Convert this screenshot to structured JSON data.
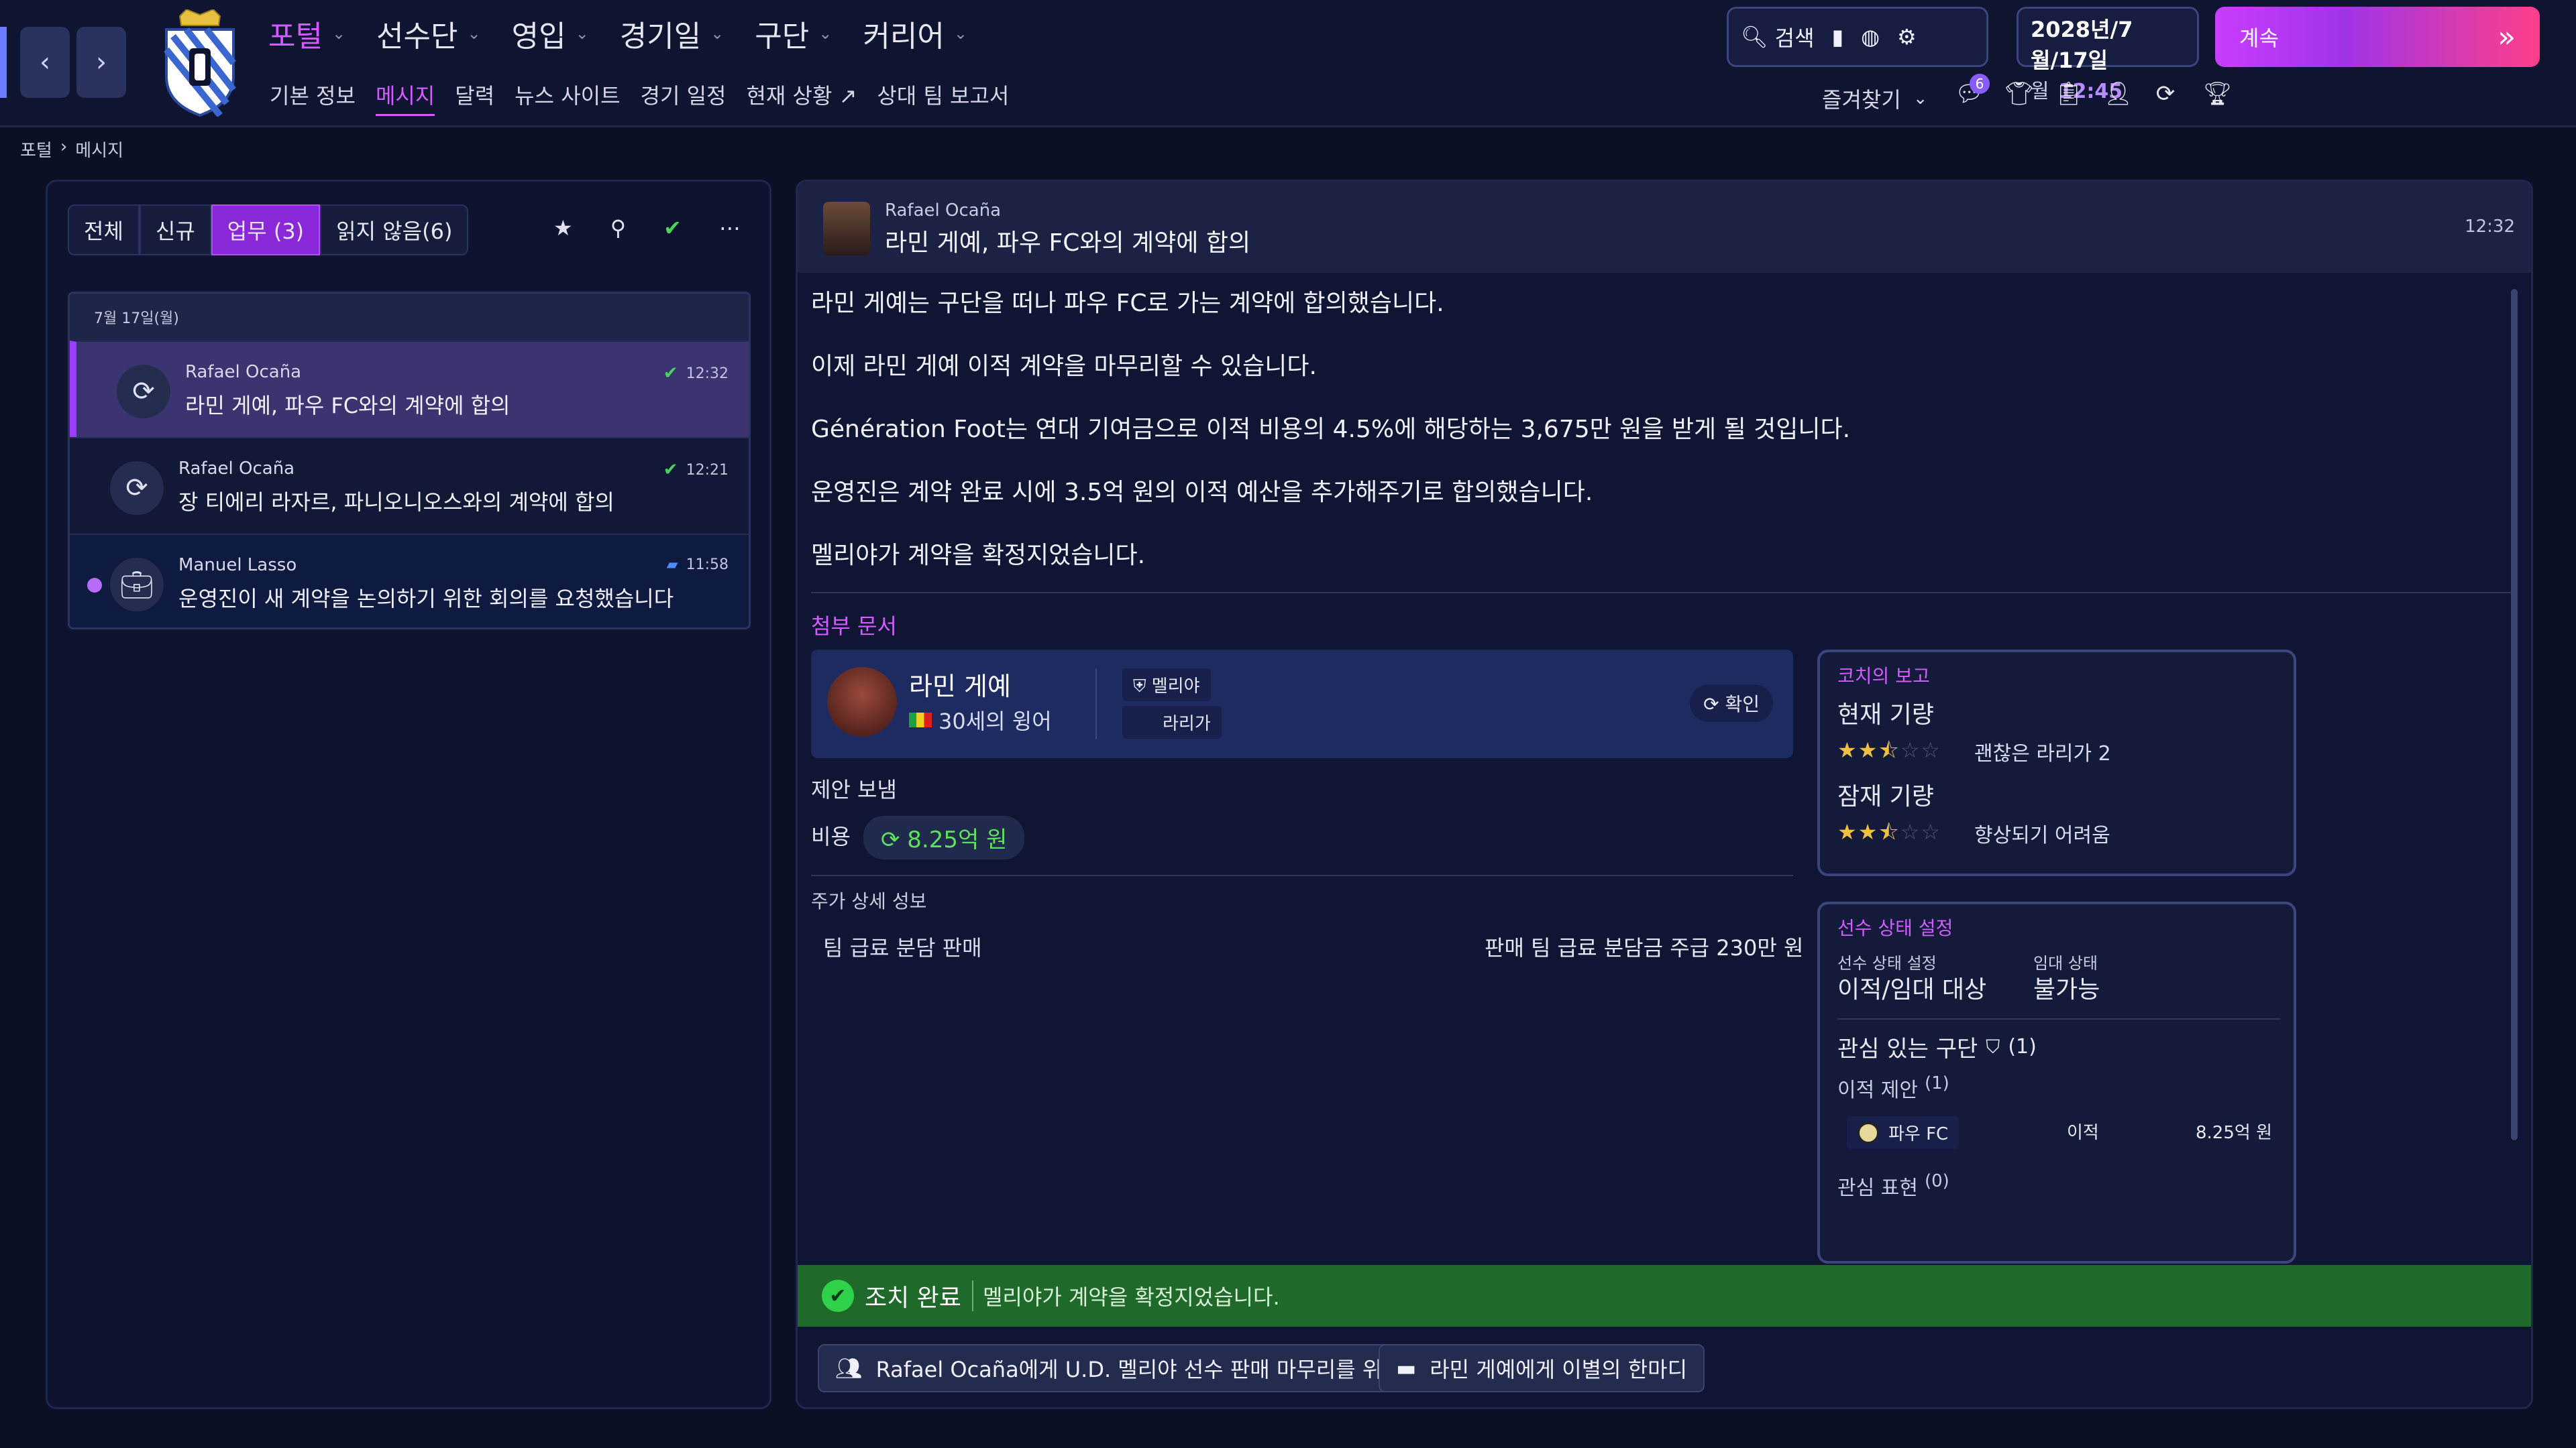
{
  "topbar": {
    "back": "‹",
    "forward": "›",
    "main_menu": [
      {
        "label": "포털",
        "active": true
      },
      {
        "label": "선수단",
        "active": false
      },
      {
        "label": "영입",
        "active": false
      },
      {
        "label": "경기일",
        "active": false
      },
      {
        "label": "구단",
        "active": false
      },
      {
        "label": "커리어",
        "active": false
      }
    ],
    "sub_menu": [
      "기본 정보",
      "메시지",
      "달력",
      "뉴스 사이트",
      "경기 일정",
      "현재 상황",
      "상대 팀 보고서"
    ],
    "search_label": "검색",
    "date_line1": "2028년/7월/17일",
    "date_weekday": "월",
    "date_time": "12:45",
    "continue_label": "계속",
    "favorites_label": "즐겨찾기",
    "notification_count": "6"
  },
  "breadcrumb": {
    "root": "포털",
    "current": "메시지"
  },
  "inbox": {
    "filters": [
      {
        "label": "전체",
        "active": false
      },
      {
        "label": "신규",
        "active": false
      },
      {
        "label": "업무 (3)",
        "active": true
      },
      {
        "label": "읽지 않음(6)",
        "active": false
      }
    ],
    "date_header": "7월 17일(월)",
    "messages": [
      {
        "sender": "Rafael Ocaña",
        "subject": "라민 게예, 파우 FC와의 계약에 합의",
        "time": "12:32",
        "selected": true,
        "unread": false
      },
      {
        "sender": "Rafael Ocaña",
        "subject": "장 티에리 라자르, 파니오니오스와의 계약에 합의",
        "time": "12:21",
        "selected": false,
        "unread": false
      },
      {
        "sender": "Manuel Lasso",
        "subject": "운영진이 새 계약을 논의하기 위한 회의를 요청했습니다",
        "time": "11:58",
        "selected": false,
        "unread": true
      }
    ]
  },
  "message": {
    "from": "Rafael Ocaña",
    "title": "라민 게예, 파우 FC와의 계약에 합의",
    "time": "12:32",
    "paragraphs": [
      "라민 게예는 구단을 떠나 파우 FC로 가는 계약에 합의했습니다.",
      "이제 라민 게예 이적 계약을 마무리할 수 있습니다.",
      "Génération Foot는 연대 기여금으로 이적 비용의 4.5%에 해당하는 3,675만 원을 받게 될 것입니다.",
      "운영진은 계약 완료 시에 3.5억 원의 이적 예산을 추가해주기로 합의했습니다.",
      "멜리야가 계약을 확정지었습니다."
    ],
    "attachments_label": "첨부 문서",
    "player": {
      "name": "라민 게예",
      "info": "30세의 윙어",
      "club": "멜리야",
      "league": "라리가",
      "confirm": "확인"
    },
    "offer_sent": "제안 보냄",
    "fee_label": "비용",
    "fee_value": "8.25억 원",
    "bonus_label": "주가 상세 성보",
    "bonus_left": "팀 급료 분담 판매",
    "bonus_right": "판매 팀 급료 분담금 주급 230만 원",
    "coach": {
      "title": "코치의 보고",
      "current_label": "현재 기량",
      "current_stars": 2.5,
      "current_text": "괜찮은 라리가 2",
      "potential_label": "잠재 기량",
      "potential_stars": 2.5,
      "potential_text": "향상되기 어려움"
    },
    "status": {
      "title": "선수 상태 설정",
      "state_label": "선수 상태 설정",
      "state_value": "이적/임대 대상",
      "loan_label": "임대 상태",
      "loan_value": "불가능",
      "interest_title": "관심 있는 구단",
      "interest_count": "(1)",
      "offers_label": "이적 제안",
      "offers_count": "(1)",
      "offer_club": "파우 FC",
      "offer_type": "이적",
      "offer_fee": "8.25억 원",
      "interest_expr_label": "관심 표현",
      "interest_expr_count": "(0)"
    },
    "done_title": "조치 완료",
    "done_text": "멜리야가 계약을 확정지었습니다.",
    "action1": "Rafael Ocaña에게 U.D. 멜리야 선수 판매 마무리를 위임",
    "action2": "라민 게예에게 이별의 한마디"
  },
  "colors": {
    "accent": "#d25cff",
    "success": "#1f6a2a",
    "panel": "#0f1532"
  }
}
